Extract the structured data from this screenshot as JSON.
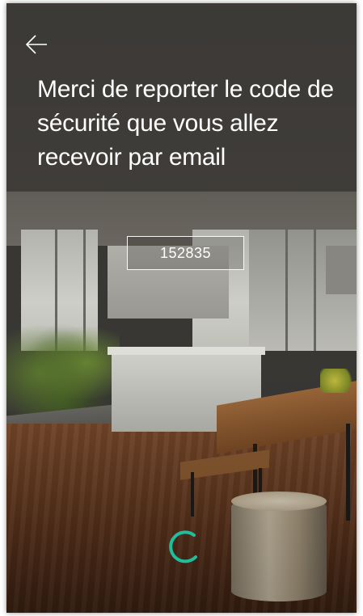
{
  "header": {
    "back_icon": "arrow-left-icon",
    "title": "Merci de reporter le code de sécurité que vous allez recevoir par email"
  },
  "code_input": {
    "value": "152835"
  },
  "loading": {
    "icon": "spinner-icon",
    "color": "#1fbf9c"
  },
  "colors": {
    "header_overlay": "#3a3835",
    "text": "#ffffff",
    "accent": "#1fbf9c"
  }
}
